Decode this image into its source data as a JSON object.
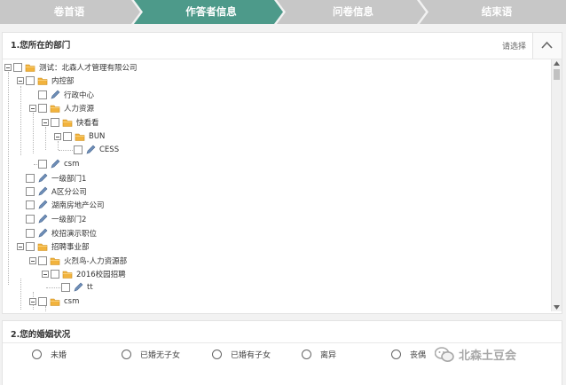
{
  "steps": [
    {
      "label": "卷首语",
      "state": "done"
    },
    {
      "label": "作答者信息",
      "state": "active"
    },
    {
      "label": "问卷信息",
      "state": "todo"
    },
    {
      "label": "结束语",
      "state": "todo"
    }
  ],
  "colors": {
    "active": "#4d9a8a",
    "inactive": "#c7c7c7",
    "folder": "#f2b33d",
    "leaf": "#6f8fb9"
  },
  "question1": {
    "title": "1.您所在的部门",
    "select_hint": "请选择",
    "collapse_icon": "chevron-up-icon",
    "tree": [
      {
        "label": "测试：北森人才管理有限公司",
        "icon": "folder-icon"
      },
      {
        "label": "内控部",
        "icon": "folder-icon"
      },
      {
        "label": "行政中心",
        "icon": "pencil-icon"
      },
      {
        "label": "人力资源",
        "icon": "folder-icon"
      },
      {
        "label": "快看看",
        "icon": "folder-icon"
      },
      {
        "label": "BUN",
        "icon": "folder-icon"
      },
      {
        "label": "CESS",
        "icon": "pencil-icon"
      },
      {
        "label": "csm",
        "icon": "pencil-icon"
      },
      {
        "label": "一级部门1",
        "icon": "pencil-icon"
      },
      {
        "label": "A区分公司",
        "icon": "pencil-icon"
      },
      {
        "label": "湖南房地产公司",
        "icon": "pencil-icon"
      },
      {
        "label": "一级部门2",
        "icon": "pencil-icon"
      },
      {
        "label": "校招演示职位",
        "icon": "pencil-icon"
      },
      {
        "label": "招聘事业部",
        "icon": "folder-icon"
      },
      {
        "label": "火烈鸟-人力资源部",
        "icon": "folder-icon"
      },
      {
        "label": "2016校园招聘",
        "icon": "folder-icon"
      },
      {
        "label": "tt",
        "icon": "pencil-icon"
      },
      {
        "label": "csm",
        "icon": "folder-icon"
      }
    ]
  },
  "question2": {
    "title": "2.您的婚姻状况",
    "options": [
      "未婚",
      "已婚无子女",
      "已婚有子女",
      "离异",
      "丧偶"
    ]
  },
  "watermark": {
    "text": "北森土豆会",
    "icon": "wechat-icon"
  }
}
